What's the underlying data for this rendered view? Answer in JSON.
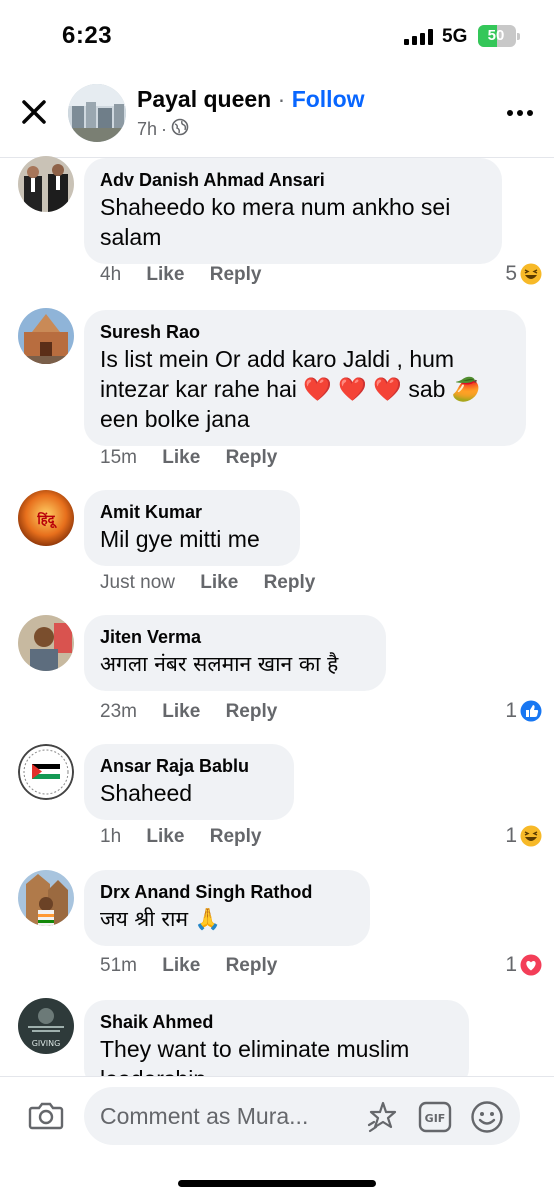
{
  "status": {
    "time": "6:23",
    "network": "5G",
    "battery": "50"
  },
  "header": {
    "page_name": "Payal queen",
    "separator": "·",
    "follow": "Follow",
    "time": "7h",
    "dot": "·"
  },
  "comments": [
    {
      "author": "Adv Danish Ahmad Ansari",
      "text": "Shaheedo ko mera num ankho sei salam",
      "time": "4h",
      "like": "Like",
      "reply": "Reply",
      "reaction_count": "5"
    },
    {
      "author": "Suresh Rao",
      "text": "Is list mein Or add karo Jaldi , hum intezar kar rahe hai ❤️ ❤️ ❤️ sab 🥭 een bolke jana",
      "time": "15m",
      "like": "Like",
      "reply": "Reply"
    },
    {
      "author": "Amit Kumar",
      "text": "Mil gye mitti me",
      "time": "Just now",
      "like": "Like",
      "reply": "Reply"
    },
    {
      "author": "Jiten Verma",
      "text": "अगला नंबर सलमान खान का है",
      "time": "23m",
      "like": "Like",
      "reply": "Reply",
      "reaction_count": "1"
    },
    {
      "author": "Ansar Raja Bablu",
      "text": "Shaheed",
      "time": "1h",
      "like": "Like",
      "reply": "Reply",
      "reaction_count": "1"
    },
    {
      "author": "Drx Anand Singh Rathod",
      "text": "जय श्री राम 🙏",
      "time": "51m",
      "like": "Like",
      "reply": "Reply",
      "reaction_count": "1"
    },
    {
      "author": "Shaik Ahmed",
      "text": "They want to eliminate muslim leadership"
    }
  ],
  "avatar_texts": {
    "amit_badge": "हिंदू",
    "shaik_badge": "GIVING"
  },
  "composer": {
    "placeholder": "Comment as Mura...",
    "gif": "GIF"
  },
  "colors": {
    "link": "#0866ff",
    "bubble": "#f0f2f5",
    "muted": "#65676b",
    "like_blue": "#1877f2",
    "love_red": "#f33e58",
    "haha_yellow": "#f7b928"
  }
}
